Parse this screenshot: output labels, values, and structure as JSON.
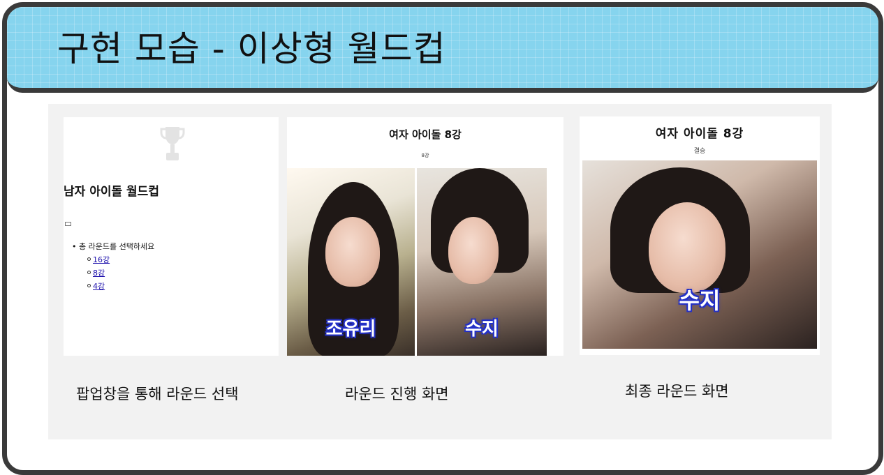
{
  "banner": {
    "title": "구현 모습 - 이상형 월드컵"
  },
  "shot1": {
    "title": "남자 아이돌 월드컵",
    "prompt": "총 라운드를 선택하세요",
    "options": [
      "16강",
      "8강",
      "4강"
    ]
  },
  "shot2": {
    "title": "여자 아이돌 8강",
    "subtitle": "8강",
    "left_name": "조유리",
    "right_name": "수지"
  },
  "shot3": {
    "title": "여자 아이돌 8강",
    "subtitle": "결승",
    "winner_name": "수지"
  },
  "captions": [
    "팝업창을 통해 라운드 선택",
    "라운드 진행 화면",
    "최종 라운드 화면"
  ],
  "colors": {
    "banner": "#86d4ee",
    "frame": "#3a3a3a",
    "panel": "#f2f2f2",
    "label_outline": "#2330c8"
  }
}
